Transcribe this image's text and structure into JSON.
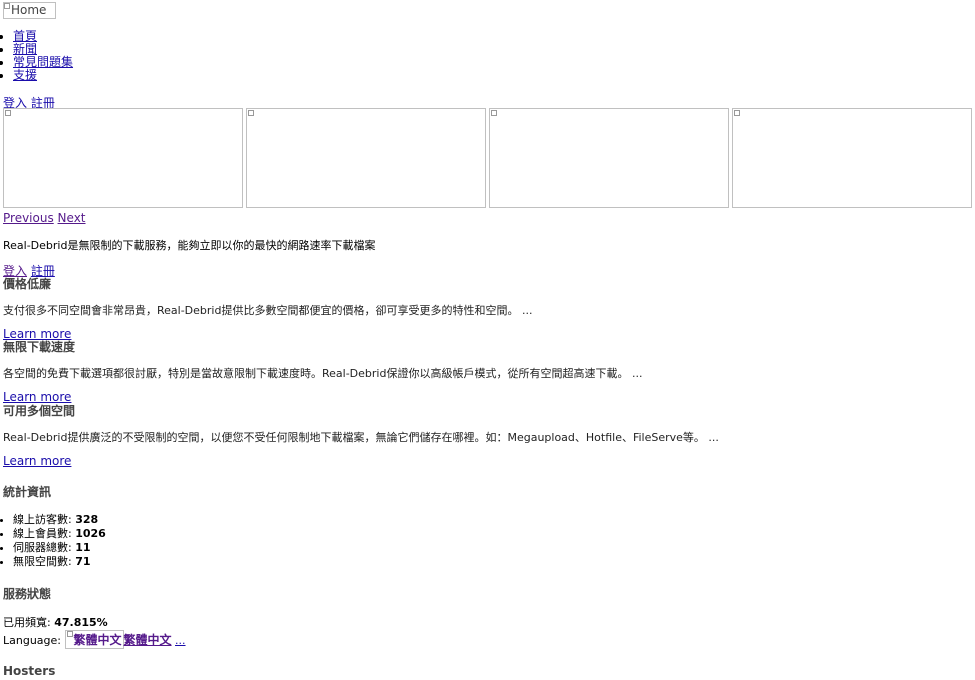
{
  "header": {
    "logo_alt": "Home"
  },
  "nav": [
    "首頁",
    "新聞",
    "常見問題集",
    "支援"
  ],
  "auth": {
    "login": "登入",
    "register": "註冊"
  },
  "slider": {
    "prev": "Previous",
    "next": "Next"
  },
  "intro": "Real-Debrid是無限制的下載服務，能夠立即以你的最快的網路速率下載檔案",
  "features": [
    {
      "title": "價格低廉",
      "text": "支付很多不同空間會非常昂貴，Real-Debrid提供比多數空間都便宜的價格，卻可享受更多的特性和空間。 ...",
      "link": "Learn more"
    },
    {
      "title": "無限下載速度",
      "text": "各空間的免費下載選項都很討厭，特別是當故意限制下載速度時。Real-Debrid保證你以高級帳戶模式，從所有空間超高速下載。 ...",
      "link": "Learn more"
    },
    {
      "title": "可用多個空間",
      "text": "Real-Debrid提供廣泛的不受限制的空間，以便您不受任何限制地下載檔案，無論它們儲存在哪裡。如：Megaupload、Hotfile、FileServe等。 ...",
      "link": "Learn more"
    }
  ],
  "stats": {
    "title": "統計資訊",
    "items": [
      {
        "label": "線上訪客數:",
        "value": "328"
      },
      {
        "label": "線上會員數:",
        "value": "1026"
      },
      {
        "label": "伺服器總數:",
        "value": "11"
      },
      {
        "label": "無限空間數:",
        "value": "71"
      }
    ]
  },
  "service": {
    "title": "服務狀態",
    "bandwidth_label": "已用頻寬:",
    "bandwidth_value": "47.815%"
  },
  "language": {
    "label": "Language:",
    "flag_alt": "繁體中文",
    "current": "繁體中文",
    "more": "..."
  },
  "hosters": {
    "title": "Hosters"
  }
}
